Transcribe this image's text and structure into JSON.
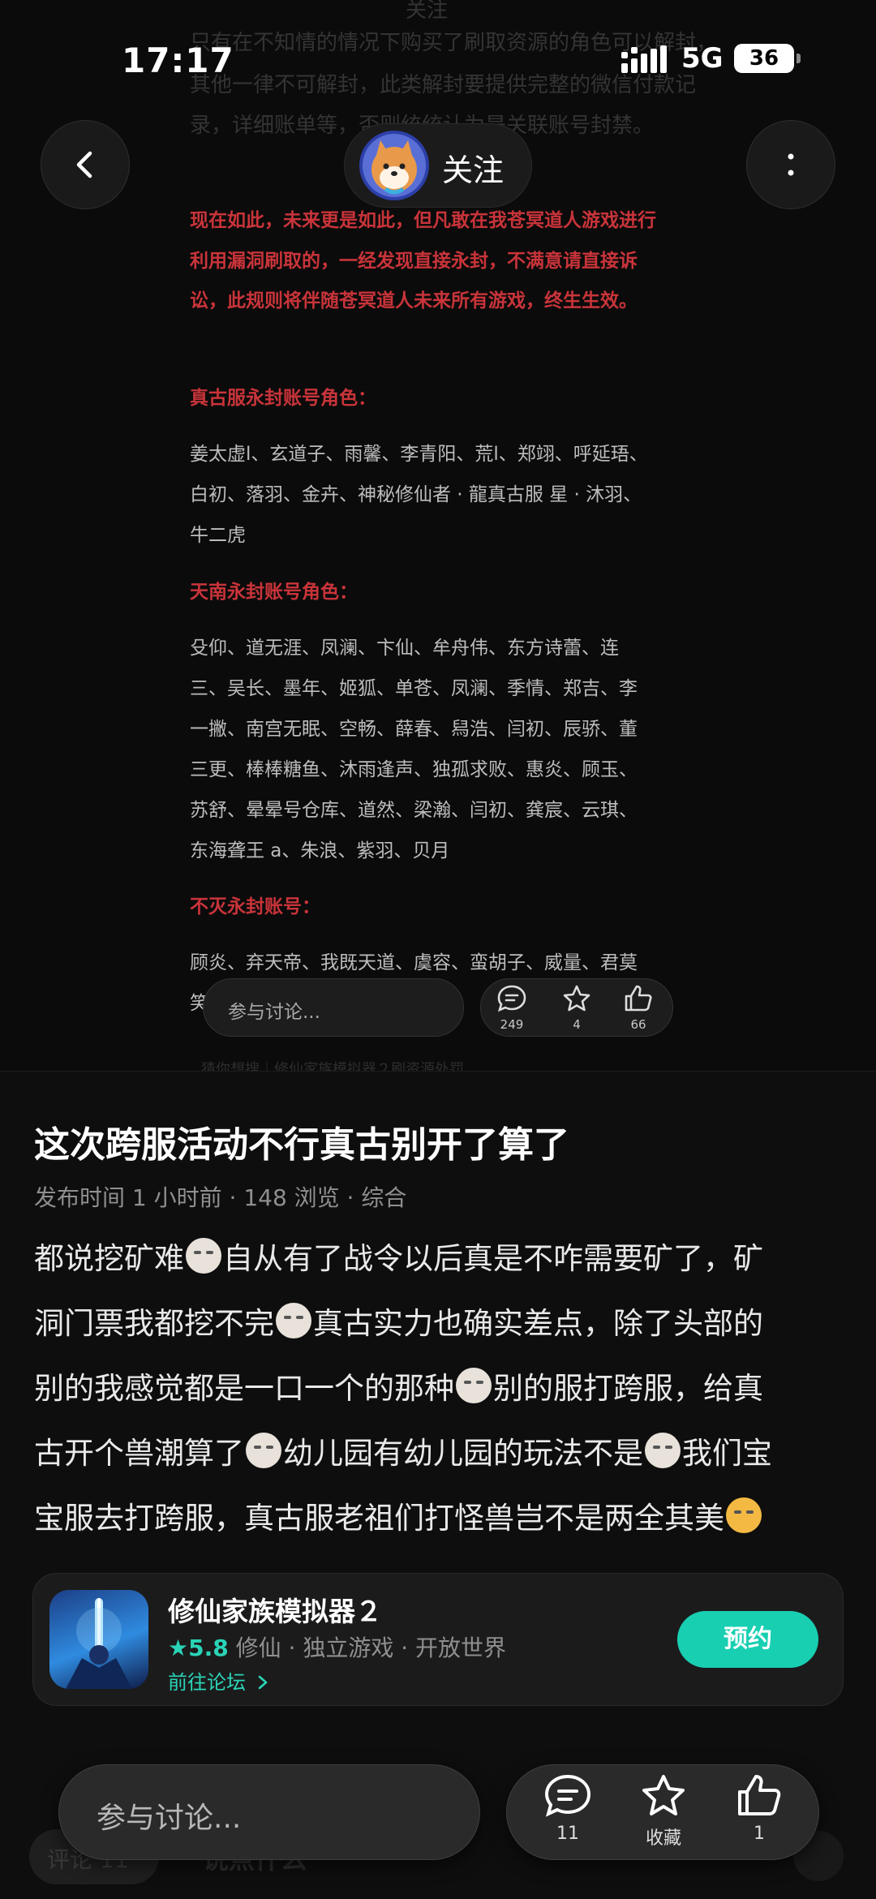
{
  "status_bar": {
    "time": "17:17",
    "network": "5G",
    "battery": "36"
  },
  "background_post": {
    "faded_lines": [
      "关注",
      "只有在不知情的情况下购买了刷取资源的角色可以解封，",
      "其他一律不可解封，此类解封要提供完整的微信付款记",
      "录，详细账单等，否则统统认为是关联账号封禁。"
    ],
    "red_paragraph": [
      "现在如此，未来更是如此，但凡敢在我苍冥道人游戏进行",
      "利用漏洞刷取的，一经发现直接永封，不满意请直接诉",
      "讼，此规则将伴随苍冥道人未来所有游戏，终生生效。"
    ],
    "sections": [
      {
        "title": "真古服永封账号角色：",
        "lines": [
          "姜太虚l、玄道子、雨馨、李青阳、荒l、郑翊、呼延珸、",
          "白初、落羽、金卉、神秘修仙者 · 龍真古服 星 · 沐羽、",
          "牛二虎"
        ]
      },
      {
        "title": "天南永封账号角色：",
        "lines": [
          "殳仰、道无涯、凤澜、卞仙、牟舟伟、东方诗蕾、连",
          "三、吴长、墨年、姬狐、单苍、凤澜、季情、郑吉、李",
          "一撇、南宫无眠、空畅、薛春、舄浩、闫初、辰骄、董",
          "三更、棒棒糖鱼、沐雨逢声、独孤求败、惠炎、顾玉、",
          "苏舒、晕晕号仓库、道然、梁瀚、闫初、龚宸、云琪、",
          "东海聋王 a、朱浪、紫羽、贝月"
        ]
      },
      {
        "title": "不灭永封账号：",
        "lines": [
          "顾炎、弃天帝、我既天道、虞容、蛮胡子、威量、君莫",
          "笑"
        ]
      }
    ],
    "follow_label": "关注",
    "mini_comment_placeholder": "参与讨论...",
    "mini_counts": {
      "comments": "249",
      "favorites": "4",
      "likes": "66"
    },
    "faded_hint": "猜你想搜｜修仙家族模拟器２刷资源处罚"
  },
  "post": {
    "title": "这次跨服活动不行真古别开了算了",
    "meta": "发布时间 1 小时前 · 148 浏览 · 综合",
    "body": {
      "l1a": "都说挖矿难",
      "l1b": "自从有了战令以后真是不咋需要矿了，矿",
      "l2a": "洞门票我都挖不完",
      "l2b": "真古实力也确实差点，除了头部的",
      "l3a": "别的我感觉都是一口一个的那种",
      "l3b": "别的服打跨服，给真",
      "l4a": "古开个兽潮算了",
      "l4b": "幼儿园有幼儿园的玩法不是",
      "l4c": "我们宝",
      "l5a": "宝服去打跨服，真古服老祖们打怪兽岂不是两全其美"
    }
  },
  "game_card": {
    "name": "修仙家族模拟器２",
    "score": "5.8",
    "tags": " 修仙 · 独立游戏 · 开放世界",
    "forum_link": "前往论坛",
    "reserve_label": "预约"
  },
  "bottom_bar": {
    "comment_placeholder": "参与讨论...",
    "comment_count": "11",
    "favorite_label": "收藏",
    "like_count": "1",
    "ghost_label": "评论 11",
    "ghost_text": "说点什么"
  },
  "colors": {
    "accent": "#18cfb2",
    "warning_red": "#c8343a",
    "sheet_bg": "#0e0e0e"
  }
}
